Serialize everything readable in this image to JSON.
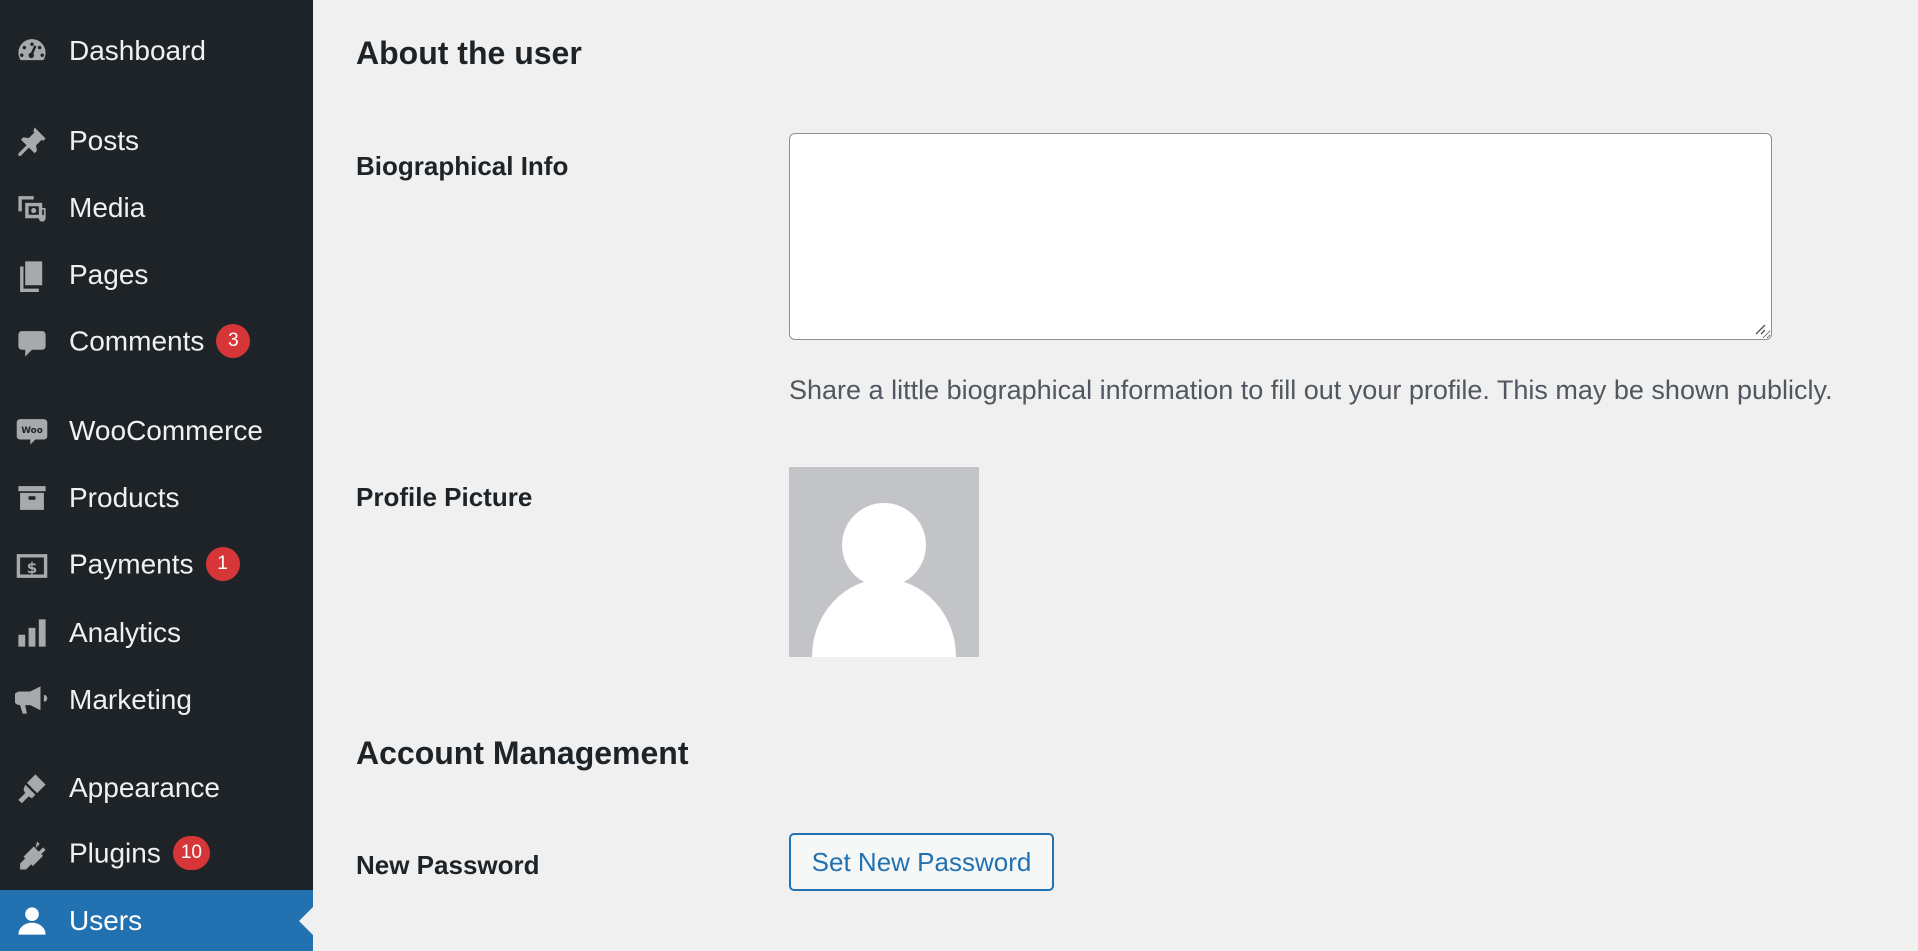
{
  "sidebar": {
    "items": [
      {
        "label": "Dashboard",
        "icon": "dashboard-icon"
      },
      {
        "label": "Posts",
        "icon": "pin-icon"
      },
      {
        "label": "Media",
        "icon": "media-icon"
      },
      {
        "label": "Pages",
        "icon": "pages-icon"
      },
      {
        "label": "Comments",
        "icon": "comment-icon",
        "badge": "3"
      },
      {
        "label": "WooCommerce",
        "icon": "woo-icon"
      },
      {
        "label": "Products",
        "icon": "archive-icon"
      },
      {
        "label": "Payments",
        "icon": "dollar-icon",
        "badge": "1"
      },
      {
        "label": "Analytics",
        "icon": "bar-chart-icon"
      },
      {
        "label": "Marketing",
        "icon": "megaphone-icon"
      },
      {
        "label": "Appearance",
        "icon": "paintbrush-icon"
      },
      {
        "label": "Plugins",
        "icon": "plug-icon",
        "badge": "10"
      },
      {
        "label": "Users",
        "icon": "user-icon",
        "active": true
      }
    ]
  },
  "about": {
    "title": "About the user",
    "bio_label": "Biographical Info",
    "bio_value": "",
    "bio_help": "Share a little biographical information to fill out your profile. This may be shown publicly.",
    "picture_label": "Profile Picture"
  },
  "account": {
    "title": "Account Management",
    "password_label": "New Password",
    "set_password_button": "Set New Password"
  },
  "colors": {
    "sidebar_bg": "#1d2327",
    "active_bg": "#2271b1",
    "badge_bg": "#d63638",
    "page_bg": "#f0f0f1",
    "link": "#2271b1"
  }
}
